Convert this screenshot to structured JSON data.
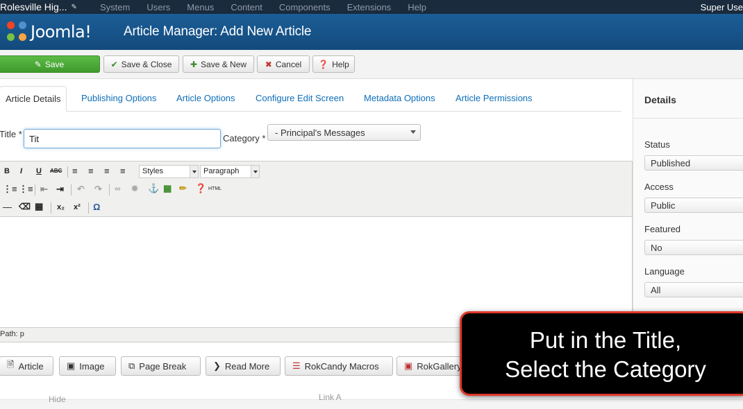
{
  "topbar": {
    "site_name": "Rolesville Hig...",
    "menu": [
      "System",
      "Users",
      "Menus",
      "Content",
      "Components",
      "Extensions",
      "Help"
    ],
    "user": "Super Use"
  },
  "header": {
    "logo_text": "Joomla!",
    "title": "Article Manager: Add New Article"
  },
  "toolbar": {
    "save": "Save",
    "save_close": "Save & Close",
    "save_new": "Save & New",
    "cancel": "Cancel",
    "help": "Help"
  },
  "tabs": [
    "Article Details",
    "Publishing Options",
    "Article Options",
    "Configure Edit Screen",
    "Metadata Options",
    "Article Permissions"
  ],
  "form": {
    "title_label": "Title *",
    "title_value": "Tit",
    "category_label": "Category *",
    "category_value": "- Principal's Messages"
  },
  "editor": {
    "styles": "Styles",
    "format": "Paragraph",
    "html_btn": "HTML",
    "path": "Path: p"
  },
  "bottom_buttons": [
    "Article",
    "Image",
    "Page Break",
    "Read More",
    "RokCandy Macros",
    "RokGallery"
  ],
  "faint_labels": {
    "left": "Hide",
    "right": "Link A"
  },
  "details": {
    "heading": "Details",
    "fields": [
      {
        "label": "Status",
        "value": "Published"
      },
      {
        "label": "Access",
        "value": "Public"
      },
      {
        "label": "Featured",
        "value": "No"
      },
      {
        "label": "Language",
        "value": "All"
      }
    ]
  },
  "callout": {
    "line1": "Put in the Title,",
    "line2": "Select the Category"
  },
  "colors": {
    "header_blue": "#17568c",
    "topbar": "#1a2b3d",
    "save_green": "#46a736",
    "link_blue": "#0e6eb8",
    "callout_border": "#e0382b"
  }
}
